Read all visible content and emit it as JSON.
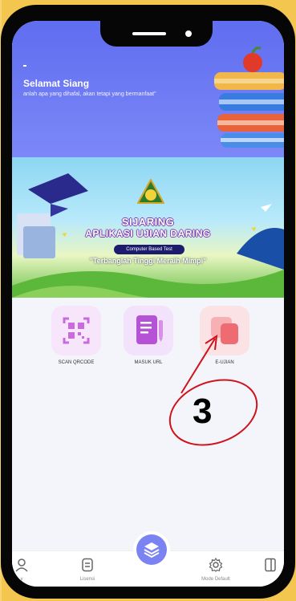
{
  "header": {
    "greeting": "Selamat Siang",
    "quote": "anlah apa yang dihafal, akan tetapi yang bermanfaat\""
  },
  "banner": {
    "title_line1": "SIJARING",
    "title_line2": "APLIKASI UJIAN DARING",
    "pill": "Computer Based Test",
    "slogan": "\"Terbanglah Tinggi Meraih Mimpi\""
  },
  "menu": {
    "items": [
      {
        "label": "SCAN QRCODE",
        "icon": "qr-scan-icon",
        "color": "#c96adf"
      },
      {
        "label": "MASUK URL",
        "icon": "document-edit-icon",
        "color": "#b552d6"
      },
      {
        "label": "E-UJIAN",
        "icon": "copy-pages-icon",
        "color": "#ef6b72"
      }
    ]
  },
  "bottom_nav": {
    "items": [
      {
        "label": "y",
        "icon": "user-icon"
      },
      {
        "label": "Lisensi",
        "icon": "license-icon"
      },
      {
        "label": "Mode Default",
        "icon": "gear-icon"
      },
      {
        "label": "",
        "icon": "exit-icon"
      }
    ],
    "center_icon": "layers-icon"
  },
  "annotation": {
    "number": "3",
    "color": "#d0121b"
  }
}
